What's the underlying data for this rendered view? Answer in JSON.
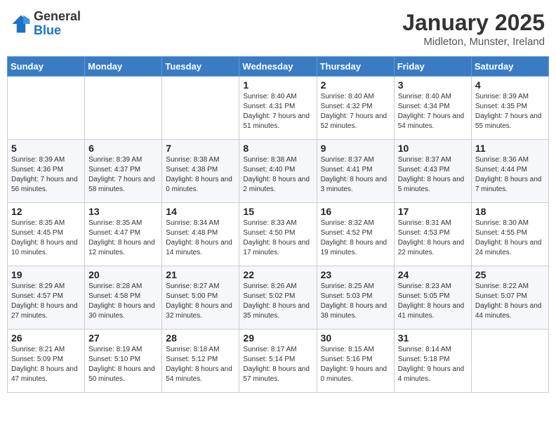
{
  "header": {
    "logo_general": "General",
    "logo_blue": "Blue",
    "month_title": "January 2025",
    "location": "Midleton, Munster, Ireland"
  },
  "days_of_week": [
    "Sunday",
    "Monday",
    "Tuesday",
    "Wednesday",
    "Thursday",
    "Friday",
    "Saturday"
  ],
  "weeks": [
    [
      {
        "num": "",
        "sunrise": "",
        "sunset": "",
        "daylight": ""
      },
      {
        "num": "",
        "sunrise": "",
        "sunset": "",
        "daylight": ""
      },
      {
        "num": "",
        "sunrise": "",
        "sunset": "",
        "daylight": ""
      },
      {
        "num": "1",
        "sunrise": "Sunrise: 8:40 AM",
        "sunset": "Sunset: 4:31 PM",
        "daylight": "Daylight: 7 hours and 51 minutes."
      },
      {
        "num": "2",
        "sunrise": "Sunrise: 8:40 AM",
        "sunset": "Sunset: 4:32 PM",
        "daylight": "Daylight: 7 hours and 52 minutes."
      },
      {
        "num": "3",
        "sunrise": "Sunrise: 8:40 AM",
        "sunset": "Sunset: 4:34 PM",
        "daylight": "Daylight: 7 hours and 54 minutes."
      },
      {
        "num": "4",
        "sunrise": "Sunrise: 8:39 AM",
        "sunset": "Sunset: 4:35 PM",
        "daylight": "Daylight: 7 hours and 55 minutes."
      }
    ],
    [
      {
        "num": "5",
        "sunrise": "Sunrise: 8:39 AM",
        "sunset": "Sunset: 4:36 PM",
        "daylight": "Daylight: 7 hours and 56 minutes."
      },
      {
        "num": "6",
        "sunrise": "Sunrise: 8:39 AM",
        "sunset": "Sunset: 4:37 PM",
        "daylight": "Daylight: 7 hours and 58 minutes."
      },
      {
        "num": "7",
        "sunrise": "Sunrise: 8:38 AM",
        "sunset": "Sunset: 4:38 PM",
        "daylight": "Daylight: 8 hours and 0 minutes."
      },
      {
        "num": "8",
        "sunrise": "Sunrise: 8:38 AM",
        "sunset": "Sunset: 4:40 PM",
        "daylight": "Daylight: 8 hours and 2 minutes."
      },
      {
        "num": "9",
        "sunrise": "Sunrise: 8:37 AM",
        "sunset": "Sunset: 4:41 PM",
        "daylight": "Daylight: 8 hours and 3 minutes."
      },
      {
        "num": "10",
        "sunrise": "Sunrise: 8:37 AM",
        "sunset": "Sunset: 4:43 PM",
        "daylight": "Daylight: 8 hours and 5 minutes."
      },
      {
        "num": "11",
        "sunrise": "Sunrise: 8:36 AM",
        "sunset": "Sunset: 4:44 PM",
        "daylight": "Daylight: 8 hours and 7 minutes."
      }
    ],
    [
      {
        "num": "12",
        "sunrise": "Sunrise: 8:35 AM",
        "sunset": "Sunset: 4:45 PM",
        "daylight": "Daylight: 8 hours and 10 minutes."
      },
      {
        "num": "13",
        "sunrise": "Sunrise: 8:35 AM",
        "sunset": "Sunset: 4:47 PM",
        "daylight": "Daylight: 8 hours and 12 minutes."
      },
      {
        "num": "14",
        "sunrise": "Sunrise: 8:34 AM",
        "sunset": "Sunset: 4:48 PM",
        "daylight": "Daylight: 8 hours and 14 minutes."
      },
      {
        "num": "15",
        "sunrise": "Sunrise: 8:33 AM",
        "sunset": "Sunset: 4:50 PM",
        "daylight": "Daylight: 8 hours and 17 minutes."
      },
      {
        "num": "16",
        "sunrise": "Sunrise: 8:32 AM",
        "sunset": "Sunset: 4:52 PM",
        "daylight": "Daylight: 8 hours and 19 minutes."
      },
      {
        "num": "17",
        "sunrise": "Sunrise: 8:31 AM",
        "sunset": "Sunset: 4:53 PM",
        "daylight": "Daylight: 8 hours and 22 minutes."
      },
      {
        "num": "18",
        "sunrise": "Sunrise: 8:30 AM",
        "sunset": "Sunset: 4:55 PM",
        "daylight": "Daylight: 8 hours and 24 minutes."
      }
    ],
    [
      {
        "num": "19",
        "sunrise": "Sunrise: 8:29 AM",
        "sunset": "Sunset: 4:57 PM",
        "daylight": "Daylight: 8 hours and 27 minutes."
      },
      {
        "num": "20",
        "sunrise": "Sunrise: 8:28 AM",
        "sunset": "Sunset: 4:58 PM",
        "daylight": "Daylight: 8 hours and 30 minutes."
      },
      {
        "num": "21",
        "sunrise": "Sunrise: 8:27 AM",
        "sunset": "Sunset: 5:00 PM",
        "daylight": "Daylight: 8 hours and 32 minutes."
      },
      {
        "num": "22",
        "sunrise": "Sunrise: 8:26 AM",
        "sunset": "Sunset: 5:02 PM",
        "daylight": "Daylight: 8 hours and 35 minutes."
      },
      {
        "num": "23",
        "sunrise": "Sunrise: 8:25 AM",
        "sunset": "Sunset: 5:03 PM",
        "daylight": "Daylight: 8 hours and 38 minutes."
      },
      {
        "num": "24",
        "sunrise": "Sunrise: 8:23 AM",
        "sunset": "Sunset: 5:05 PM",
        "daylight": "Daylight: 8 hours and 41 minutes."
      },
      {
        "num": "25",
        "sunrise": "Sunrise: 8:22 AM",
        "sunset": "Sunset: 5:07 PM",
        "daylight": "Daylight: 8 hours and 44 minutes."
      }
    ],
    [
      {
        "num": "26",
        "sunrise": "Sunrise: 8:21 AM",
        "sunset": "Sunset: 5:09 PM",
        "daylight": "Daylight: 8 hours and 47 minutes."
      },
      {
        "num": "27",
        "sunrise": "Sunrise: 8:19 AM",
        "sunset": "Sunset: 5:10 PM",
        "daylight": "Daylight: 8 hours and 50 minutes."
      },
      {
        "num": "28",
        "sunrise": "Sunrise: 8:18 AM",
        "sunset": "Sunset: 5:12 PM",
        "daylight": "Daylight: 8 hours and 54 minutes."
      },
      {
        "num": "29",
        "sunrise": "Sunrise: 8:17 AM",
        "sunset": "Sunset: 5:14 PM",
        "daylight": "Daylight: 8 hours and 57 minutes."
      },
      {
        "num": "30",
        "sunrise": "Sunrise: 8:15 AM",
        "sunset": "Sunset: 5:16 PM",
        "daylight": "Daylight: 9 hours and 0 minutes."
      },
      {
        "num": "31",
        "sunrise": "Sunrise: 8:14 AM",
        "sunset": "Sunset: 5:18 PM",
        "daylight": "Daylight: 9 hours and 4 minutes."
      },
      {
        "num": "",
        "sunrise": "",
        "sunset": "",
        "daylight": ""
      }
    ]
  ]
}
